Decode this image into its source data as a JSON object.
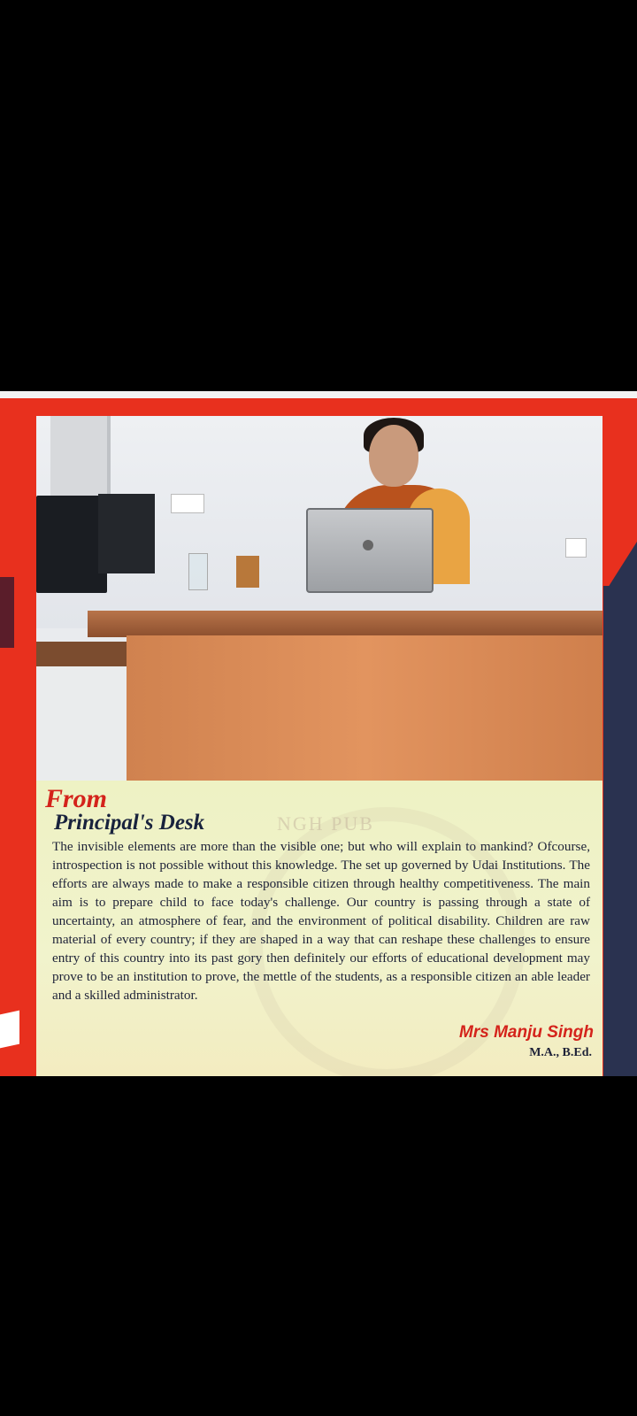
{
  "document": {
    "heading_line1": "From",
    "heading_line2": "Principal's Desk",
    "watermark": "NGH PUB",
    "body": "The invisible elements are more than the visible one; but who will explain to mankind? Ofcourse, introspection is not possible without this knowledge. The set up governed by Udai Institutions. The efforts are always made to make a responsible citizen through healthy competitiveness. The main aim is to prepare child to face today's challenge. Our country is passing through a state of uncertainty, an atmosphere of fear, and the environment of political disability. Children are raw material of every country; if they are shaped in a way that can reshape these challenges to ensure entry of this country into its past gory then definitely our efforts of educational development may prove to be an institution to prove, the mettle of the students, as a responsible citizen an able leader and a skilled administrator.",
    "signatory_name": "Mrs Manju Singh",
    "signatory_qualification": "M.A., B.Ed."
  },
  "colors": {
    "frame_red": "#e8301e",
    "heading_red": "#d4231b",
    "heading_navy": "#18223d",
    "panel_bg": "#eef2c4"
  },
  "photo": {
    "description_icon": "principal-photo"
  }
}
